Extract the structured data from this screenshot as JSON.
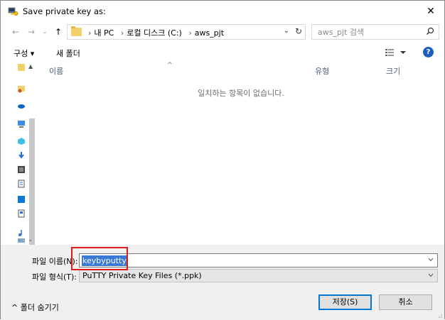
{
  "window": {
    "title": "Save private key as:",
    "close_symbol": "✕"
  },
  "nav": {
    "back_symbol": "←",
    "forward_symbol": "→",
    "recent_symbol": "⌄",
    "up_symbol": "↑"
  },
  "address": {
    "crumbs": [
      "내 PC",
      "로컬 디스크 (C:)",
      "aws_pjt"
    ],
    "separator": "›",
    "dropdown_symbol": "⌄",
    "refresh_symbol": "↻"
  },
  "search": {
    "placeholder": "aws_pjt 검색"
  },
  "toolbar": {
    "organize_label": "구성 ▾",
    "new_folder_label": "새 폴더",
    "help_label": "?"
  },
  "filelist": {
    "columns": [
      "이름",
      "유형",
      "크기"
    ],
    "empty_message": "일치하는 항목이 없습니다."
  },
  "form": {
    "filename_label": "파일 이름(N):",
    "filename_value": "keybyputty",
    "filetype_label": "파일 형식(T):",
    "filetype_value": "PuTTY Private Key Files (*.ppk)"
  },
  "footer": {
    "hide_folders_label": "^ 폴더 숨기기",
    "save_label": "저장(S)",
    "cancel_label": "취소"
  },
  "colors": {
    "selection": "#3a7ad6",
    "highlight_box": "#e01b1b",
    "help_icon": "#1d5fbf",
    "column_header": "#4c607a"
  }
}
